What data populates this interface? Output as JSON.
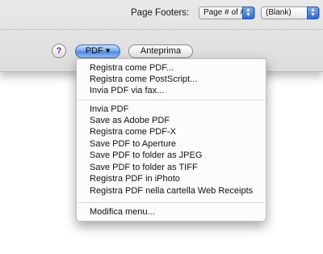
{
  "sheet": {
    "footers_label": "Page Footers:",
    "footer_popup_value": "Page # of #",
    "blank_popup_value": "(Blank)"
  },
  "buttons": {
    "help_label": "?",
    "pdf_label": "PDF ▾",
    "preview_label": "Anteprima"
  },
  "menu": {
    "group1": [
      "Registra come PDF...",
      "Registra come PostScript...",
      "Invia PDF via fax..."
    ],
    "group2": [
      "Invia PDF",
      "Save as Adobe PDF",
      "Registra come PDF-X",
      "Save PDF to Aperture",
      "Save PDF to folder as JPEG",
      "Save PDF to folder as TIFF",
      "Registra PDF in iPhoto",
      "Registra PDF nella cartella Web Receipts"
    ],
    "group3": [
      "Modifica menu..."
    ]
  },
  "colors": {
    "accent_blue": "#4a86e3",
    "help_glyph": "#5a2f9a"
  }
}
